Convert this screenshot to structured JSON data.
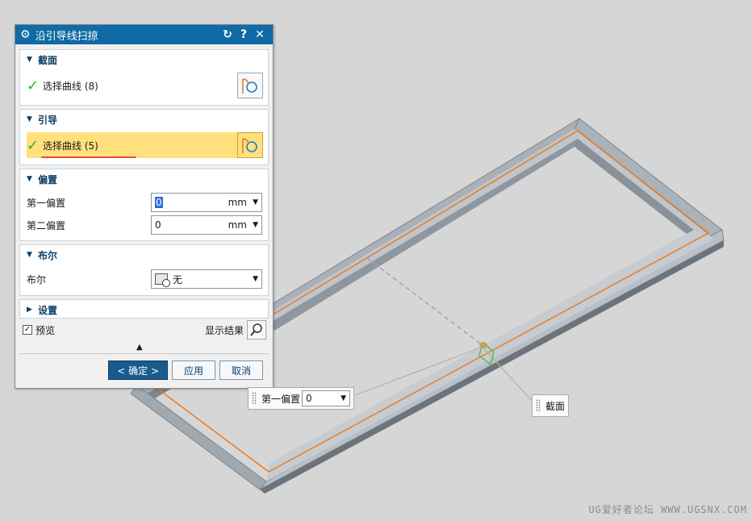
{
  "dialog": {
    "title": "沿引导线扫掠",
    "title_icon": "gear-icon",
    "reset_icon": "reset-icon",
    "help_label": "?",
    "close_label": "✕"
  },
  "section": {
    "heading": "截面",
    "select_label": "选择曲线 (8)"
  },
  "guide": {
    "heading": "引导",
    "select_label": "选择曲线 (5)"
  },
  "offset": {
    "heading": "偏置",
    "first_label": "第一偏置",
    "first_value": "0",
    "first_unit": "mm",
    "second_label": "第二偏置",
    "second_value": "0",
    "second_unit": "mm"
  },
  "boolean": {
    "heading": "布尔",
    "label": "布尔",
    "value": "无"
  },
  "settings": {
    "heading": "设置"
  },
  "footer": {
    "preview_label": "预览",
    "show_result_label": "显示结果",
    "ok_label": "< 确定 >",
    "apply_label": "应用",
    "cancel_label": "取消"
  },
  "viewport_labels": {
    "offset_label": "第一偏置",
    "offset_value": "0",
    "section_label": "截面"
  },
  "watermark": "UG爱好者论坛 WWW.UGSNX.COM",
  "colors": {
    "titlebar": "#0f6aa5",
    "active_row": "#ffe07c",
    "check": "#2db31f",
    "guide_line": "#f07a1a",
    "frame_light": "#b7bec6",
    "frame_dark": "#6f7780"
  }
}
